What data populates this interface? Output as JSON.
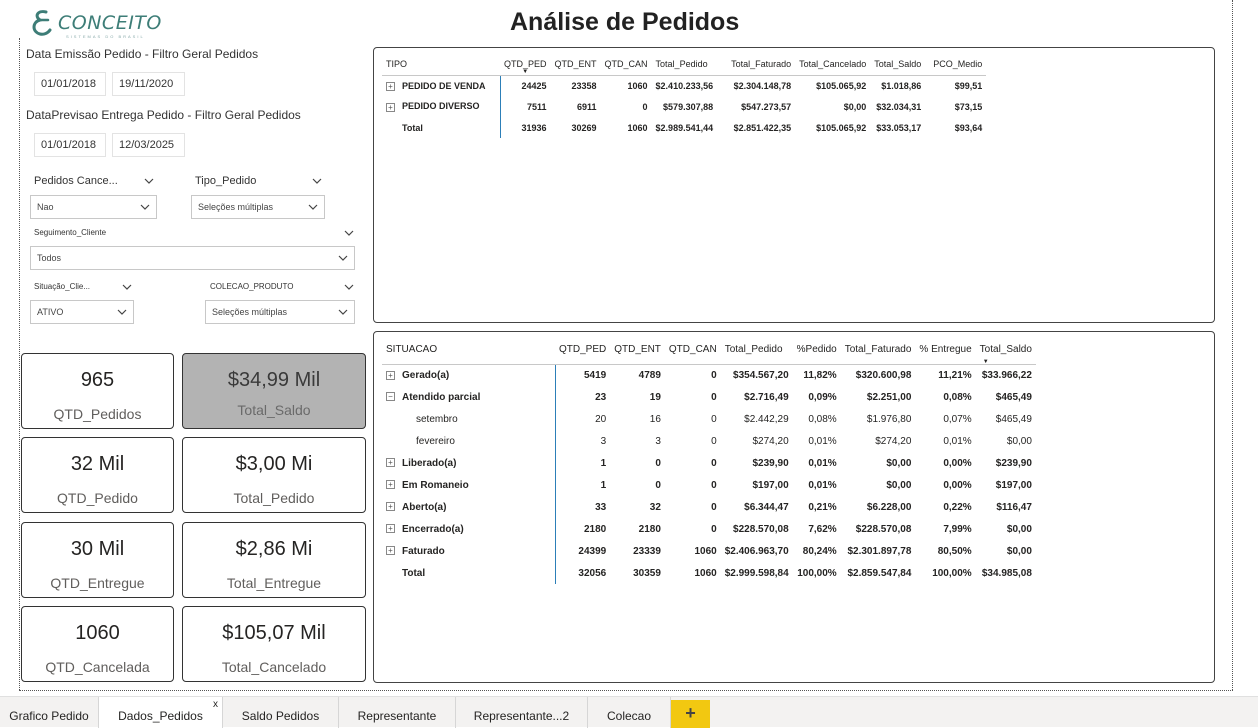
{
  "header": {
    "title": "Análise de Pedidos",
    "brand": "CONCEITO",
    "brand_tagline": "SISTEMAS DO BRASIL"
  },
  "filters": {
    "emissao": {
      "label": "Data Emissão Pedido - Filtro Geral Pedidos",
      "from": "01/01/2018",
      "to": "19/11/2020"
    },
    "previsao": {
      "label": "DataPrevisao Entrega Pedido - Filtro Geral Pedidos",
      "from": "01/01/2018",
      "to": "12/03/2025"
    },
    "cancelados": {
      "label": "Pedidos Cance...",
      "value": "Nao"
    },
    "tipo_pedido": {
      "label": "Tipo_Pedido",
      "value": "Seleções múltiplas"
    },
    "segmento": {
      "label": "Seguimento_Cliente",
      "value": "Todos"
    },
    "situacao_cliente": {
      "label": "Situação_Clie...",
      "value": "ATIVO"
    },
    "colecao": {
      "label": "COLECAO_PRODUTO",
      "value": "Seleções múltiplas"
    }
  },
  "cards": [
    {
      "value": "965",
      "caption": "QTD_Pedidos"
    },
    {
      "value": "$34,99 Mil",
      "caption": "Total_Saldo"
    },
    {
      "value": "32 Mil",
      "caption": "QTD_Pedido"
    },
    {
      "value": "$3,00 Mi",
      "caption": "Total_Pedido"
    },
    {
      "value": "30 Mil",
      "caption": "QTD_Entregue"
    },
    {
      "value": "$2,86 Mi",
      "caption": "Total_Entregue"
    },
    {
      "value": "1060",
      "caption": "QTD_Cancelada"
    },
    {
      "value": "$105,07 Mil",
      "caption": "Total_Cancelado"
    }
  ],
  "tipo_table": {
    "headers": [
      "TIPO",
      "QTD_PED",
      "QTD_ENT",
      "QTD_CAN",
      "Total_Pedido",
      "Total_Faturado",
      "Total_Cancelado",
      "Total_Saldo",
      "PCO_Medio"
    ],
    "rows": [
      [
        "PEDIDO DE VENDA",
        "24425",
        "23358",
        "1060",
        "$2.410.233,56",
        "$2.304.148,78",
        "$105.065,92",
        "$1.018,86",
        "$99,51"
      ],
      [
        "PEDIDO DIVERSO",
        "7511",
        "6911",
        "0",
        "$579.307,88",
        "$547.273,57",
        "$0,00",
        "$32.034,31",
        "$73,15"
      ],
      [
        "Total",
        "31936",
        "30269",
        "1060",
        "$2.989.541,44",
        "$2.851.422,35",
        "$105.065,92",
        "$33.053,17",
        "$93,64"
      ]
    ]
  },
  "situacao_table": {
    "headers": [
      "SITUACAO",
      "QTD_PED",
      "QTD_ENT",
      "QTD_CAN",
      "Total_Pedido",
      "%Pedido",
      "Total_Faturado",
      "% Entregue",
      "Total_Saldo"
    ],
    "rows": [
      [
        "Gerado(a)",
        "5419",
        "4789",
        "0",
        "$354.567,20",
        "11,82%",
        "$320.600,98",
        "11,21%",
        "$33.966,22"
      ],
      [
        "Atendido parcial",
        "23",
        "19",
        "0",
        "$2.716,49",
        "0,09%",
        "$2.251,00",
        "0,08%",
        "$465,49"
      ],
      [
        "setembro",
        "20",
        "16",
        "0",
        "$2.442,29",
        "0,08%",
        "$1.976,80",
        "0,07%",
        "$465,49"
      ],
      [
        "fevereiro",
        "3",
        "3",
        "0",
        "$274,20",
        "0,01%",
        "$274,20",
        "0,01%",
        "$0,00"
      ],
      [
        "Liberado(a)",
        "1",
        "0",
        "0",
        "$239,90",
        "0,01%",
        "$0,00",
        "0,00%",
        "$239,90"
      ],
      [
        "Em Romaneio",
        "1",
        "0",
        "0",
        "$197,00",
        "0,01%",
        "$0,00",
        "0,00%",
        "$197,00"
      ],
      [
        "Aberto(a)",
        "33",
        "32",
        "0",
        "$6.344,47",
        "0,21%",
        "$6.228,00",
        "0,22%",
        "$116,47"
      ],
      [
        "Encerrado(a)",
        "2180",
        "2180",
        "0",
        "$228.570,08",
        "7,62%",
        "$228.570,08",
        "7,99%",
        "$0,00"
      ],
      [
        "Faturado",
        "24399",
        "23339",
        "1060",
        "$2.406.963,70",
        "80,24%",
        "$2.301.897,78",
        "80,50%",
        "$0,00"
      ],
      [
        "Total",
        "32056",
        "30359",
        "1060",
        "$2.999.598,84",
        "100,00%",
        "$2.859.547,84",
        "100,00%",
        "$34.985,08"
      ]
    ]
  },
  "tabs": [
    "Grafico Pedido",
    "Dados_Pedidos",
    "Saldo Pedidos",
    "Representante",
    "Representante...2",
    "Colecao"
  ],
  "tab_close": "x",
  "add_tab": "+"
}
